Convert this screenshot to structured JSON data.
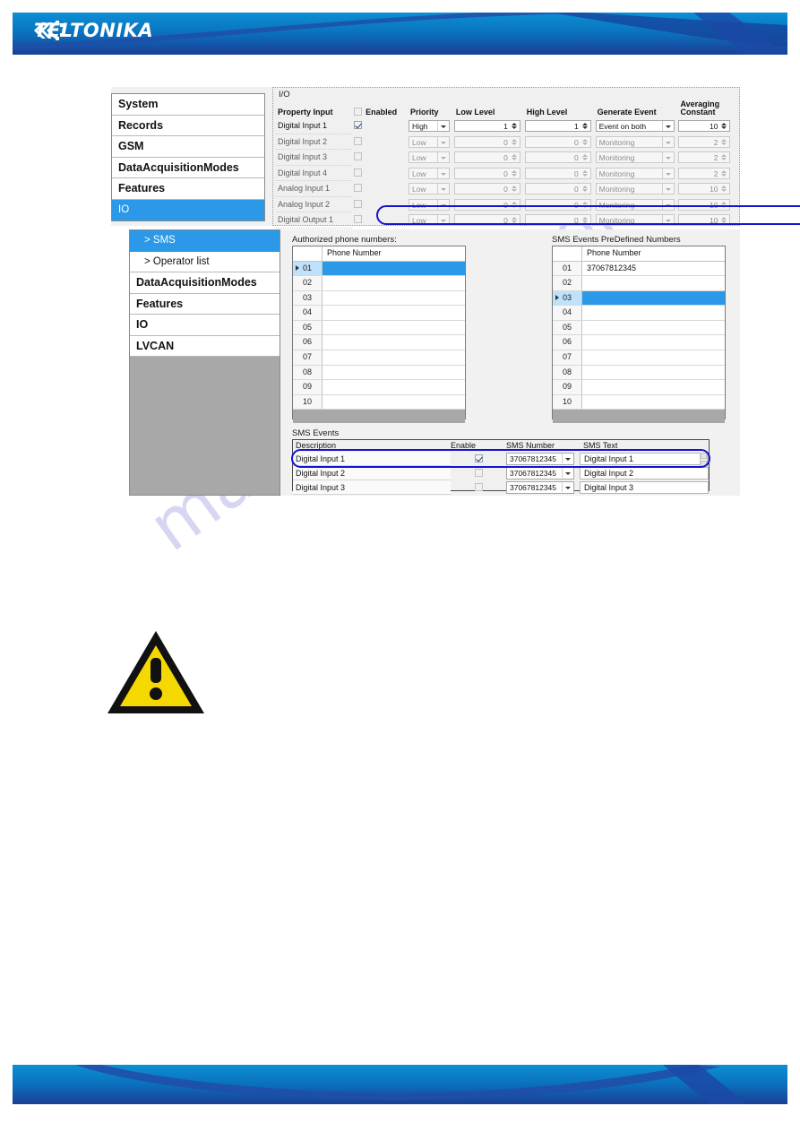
{
  "header": {
    "brand": "TELTONIKA",
    "logo_icon": "teltonika-chevrons-icon"
  },
  "watermark": {
    "text": "manualshive.com"
  },
  "io_panel": {
    "group_caption": "I/O",
    "nav": {
      "items": [
        {
          "label": "System",
          "selected": false
        },
        {
          "label": "Records",
          "selected": false
        },
        {
          "label": "GSM",
          "selected": false
        },
        {
          "label": "DataAcquisitionModes",
          "selected": false
        },
        {
          "label": "Features",
          "selected": false
        },
        {
          "label": "IO",
          "selected": true
        }
      ]
    },
    "columns": {
      "property_input": "Property Input",
      "enabled": "Enabled",
      "priority": "Priority",
      "low_level": "Low Level",
      "high_level": "High Level",
      "generate_event": "Generate Event",
      "averaging_constant_line1": "Averaging",
      "averaging_constant_line2": "Constant"
    },
    "rows": [
      {
        "property": "Digital Input 1",
        "enabled": true,
        "priority": "High",
        "low_level": "1",
        "high_level": "1",
        "generate_event": "Event on both",
        "averaging_constant": "10",
        "active": true
      },
      {
        "property": "Digital Input 2",
        "enabled": false,
        "priority": "Low",
        "low_level": "0",
        "high_level": "0",
        "generate_event": "Monitoring",
        "averaging_constant": "2",
        "active": false
      },
      {
        "property": "Digital Input 3",
        "enabled": false,
        "priority": "Low",
        "low_level": "0",
        "high_level": "0",
        "generate_event": "Monitoring",
        "averaging_constant": "2",
        "active": false
      },
      {
        "property": "Digital Input 4",
        "enabled": false,
        "priority": "Low",
        "low_level": "0",
        "high_level": "0",
        "generate_event": "Monitoring",
        "averaging_constant": "2",
        "active": false
      },
      {
        "property": "Analog Input 1",
        "enabled": false,
        "priority": "Low",
        "low_level": "0",
        "high_level": "0",
        "generate_event": "Monitoring",
        "averaging_constant": "10",
        "active": false
      },
      {
        "property": "Analog Input 2",
        "enabled": false,
        "priority": "Low",
        "low_level": "0",
        "high_level": "0",
        "generate_event": "Monitoring",
        "averaging_constant": "10",
        "active": false
      },
      {
        "property": "Digital Output 1",
        "enabled": false,
        "priority": "Low",
        "low_level": "0",
        "high_level": "0",
        "generate_event": "Monitoring",
        "averaging_constant": "10",
        "active": false
      }
    ]
  },
  "sms_panel": {
    "nav": {
      "items": [
        {
          "label": "> SMS",
          "selected": true,
          "sub": true
        },
        {
          "label": "> Operator list",
          "selected": false,
          "sub": true
        },
        {
          "label": "DataAcquisitionModes",
          "selected": false,
          "sub": false
        },
        {
          "label": "Features",
          "selected": false,
          "sub": false
        },
        {
          "label": "IO",
          "selected": false,
          "sub": false
        },
        {
          "label": "LVCAN",
          "selected": false,
          "sub": false
        }
      ]
    },
    "authorized": {
      "caption": "Authorized phone numbers:",
      "column_header": "Phone Number",
      "rows": [
        {
          "idx": "01",
          "value": "",
          "selected": true
        },
        {
          "idx": "02",
          "value": "",
          "selected": false
        },
        {
          "idx": "03",
          "value": "",
          "selected": false
        },
        {
          "idx": "04",
          "value": "",
          "selected": false
        },
        {
          "idx": "05",
          "value": "",
          "selected": false
        },
        {
          "idx": "06",
          "value": "",
          "selected": false
        },
        {
          "idx": "07",
          "value": "",
          "selected": false
        },
        {
          "idx": "08",
          "value": "",
          "selected": false
        },
        {
          "idx": "09",
          "value": "",
          "selected": false
        },
        {
          "idx": "10",
          "value": "",
          "selected": false
        }
      ]
    },
    "predefined": {
      "caption": "SMS Events PreDefined Numbers",
      "column_header": "Phone Number",
      "rows": [
        {
          "idx": "01",
          "value": "37067812345",
          "selected": false
        },
        {
          "idx": "02",
          "value": "",
          "selected": false
        },
        {
          "idx": "03",
          "value": "",
          "selected": true
        },
        {
          "idx": "04",
          "value": "",
          "selected": false
        },
        {
          "idx": "05",
          "value": "",
          "selected": false
        },
        {
          "idx": "06",
          "value": "",
          "selected": false
        },
        {
          "idx": "07",
          "value": "",
          "selected": false
        },
        {
          "idx": "08",
          "value": "",
          "selected": false
        },
        {
          "idx": "09",
          "value": "",
          "selected": false
        },
        {
          "idx": "10",
          "value": "",
          "selected": false
        }
      ]
    },
    "events": {
      "caption": "SMS Events",
      "columns": {
        "description": "Description",
        "enable": "Enable",
        "sms_number": "SMS Number",
        "sms_text": "SMS Text"
      },
      "rows": [
        {
          "description": "Digital Input 1",
          "enable": true,
          "sms_number": "37067812345",
          "sms_text": "Digital Input 1",
          "active": true
        },
        {
          "description": "Digital Input 2",
          "enable": false,
          "sms_number": "37067812345",
          "sms_text": "Digital Input 2",
          "active": false
        },
        {
          "description": "Digital Input 3",
          "enable": false,
          "sms_number": "37067812345",
          "sms_text": "Digital Input 3",
          "active": false
        }
      ]
    }
  },
  "notice": {
    "icon": "warning-triangle-icon"
  },
  "colors": {
    "accent_blue": "#2b99e8",
    "highlight_outline": "#1414cf",
    "banner_top": "#0c8fd4",
    "banner_bottom": "#1a3f96",
    "warning_yellow": "#f5d800",
    "watermark": "#c9c9ef"
  }
}
